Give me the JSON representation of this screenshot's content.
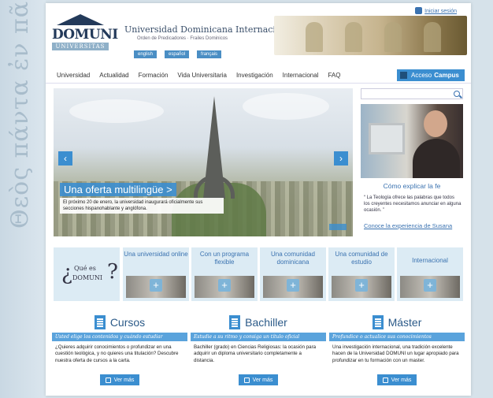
{
  "side": {
    "text": "Θεὸς πάντα ἐν πᾶσιν"
  },
  "header": {
    "logo": "DOMUNI",
    "logo_sub": "UNIVERSITAS",
    "title": "Universidad Dominicana Internacional",
    "subtitle": "Orden de Predicadores · Frailes Dominicos",
    "languages": [
      "english",
      "español",
      "français"
    ],
    "login": "Iniciar sesión"
  },
  "nav": {
    "items": [
      "Universidad",
      "Actualidad",
      "Formación",
      "Vida Universitaria",
      "Investigación",
      "Internacional",
      "FAQ"
    ],
    "campus_prefix": "Acceso",
    "campus_bold": "Campus"
  },
  "hero": {
    "title": "Una oferta multilingüe >",
    "description": "El próximo 20 de enero, la universidad inaugurará oficialmente sus secciones hispanohablante y anglófona."
  },
  "right": {
    "title": "Cómo explicar la fe",
    "quote": "“ La Teología ofrece las palabras que todos los creyentes necesitamos anunciar en alguna ocasión. ”",
    "link": "Conoce la experiencia de Susana"
  },
  "tiles": {
    "que_small": "Qué es",
    "que_big": "DOMUNI",
    "items": [
      "Una universidad online",
      "Con un programa flexible",
      "Una comunidad dominicana",
      "Una comunidad de estudio",
      "Internacional"
    ]
  },
  "columns": [
    {
      "title": "Cursos",
      "bar": "Usted elige los contenidos y cuándo estudiar",
      "text": "¿Quieres adquirir conocimientos o profundizar en una cuestión teológica, y no quieres una titulación? Descubre nuestra oferta de cursos a la carta.",
      "button": "Ver más"
    },
    {
      "title": "Bachiller",
      "bar": "Estudie a su ritmo y consiga un título oficial",
      "text": "Bachiller (grado) en Ciencias Religiosas: la ocasión para adquirir un diploma universitario completamente a distancia.",
      "button": "Ver más"
    },
    {
      "title": "Máster",
      "bar": "Profundice o actualice sus conocimientos",
      "text": "Una investigación internacional, una tradición excelente hacen de la Universidad DOMUNI un lugar apropiado para profundizar en tu formación con un master.",
      "button": "Ver más"
    }
  ]
}
